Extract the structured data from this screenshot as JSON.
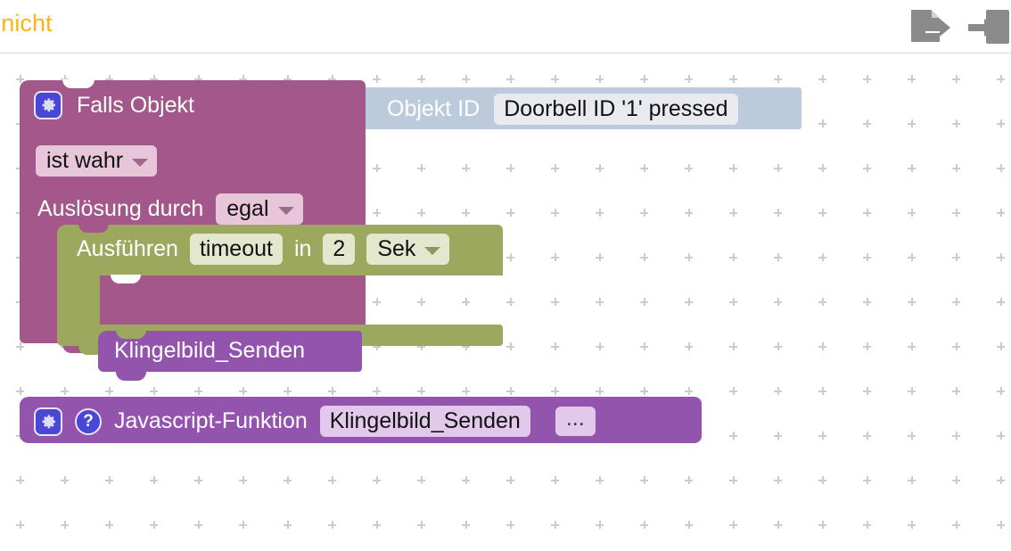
{
  "topbar": {
    "title_truncated": "t nicht",
    "title_color": "#fbb515",
    "icons": [
      {
        "name": "export-file-icon",
        "glyph": "file-arrow-right"
      },
      {
        "name": "import-file-icon",
        "glyph": "arrow-into-box"
      }
    ]
  },
  "canvas": {
    "grid_mark": "plus",
    "grid_color": "#cccccc",
    "grid_spacing": 50,
    "background": "#ffffff"
  },
  "blocks": {
    "if_block": {
      "name": "falls-objekt-block",
      "color": "#a4578a",
      "gear_icon": "gear-icon",
      "label": "Falls Objekt",
      "condition_dropdown": "ist wahr",
      "trigger_label": "Auslösung durch",
      "trigger_dropdown": "egal"
    },
    "object_id_block": {
      "name": "objekt-id-block",
      "color": "#bccbdb",
      "label": "Objekt ID",
      "value": "Doorbell ID '1' pressed"
    },
    "timeout_block": {
      "name": "ausfuehren-timeout-block",
      "color": "#9ba85e",
      "label": "Ausführen",
      "name_field": "timeout",
      "in_label": "in",
      "delay_value": "2",
      "unit_dropdown": "Sek"
    },
    "call_block": {
      "name": "klingelbild-senden-call-block",
      "color": "#9354ad",
      "label": "Klingelbild_Senden"
    },
    "js_function_block": {
      "name": "javascript-funktion-block",
      "color": "#9354ad",
      "gear_icon": "gear-icon",
      "help_icon": "help-icon",
      "label": "Javascript-Funktion",
      "function_name": "Klingelbild_Senden",
      "more_label": "..."
    }
  }
}
